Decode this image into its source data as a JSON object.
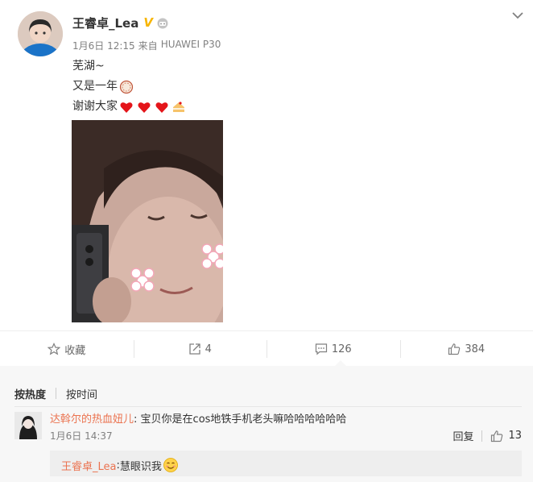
{
  "post": {
    "author": "王睿卓_Lea",
    "date": "1月6日 12:15",
    "source_prefix": "来自",
    "source": "HUAWEI P30",
    "lines": [
      "芜湖~",
      "又是一年",
      "谢谢大家"
    ]
  },
  "icons": {
    "verified": "verified-v-icon",
    "bot": "robot-icon",
    "dropdown": "chevron-down-icon",
    "star": "star-icon",
    "repost": "repost-icon",
    "comment": "comment-icon",
    "like": "thumbs-up-icon"
  },
  "actions": {
    "favorite_label": "收藏",
    "repost_count": "4",
    "comment_count": "126",
    "like_count": "384"
  },
  "sort": {
    "hot": "按热度",
    "time": "按时间"
  },
  "comment": {
    "user": "达斡尔的热血妞儿",
    "separator": ":",
    "text": "宝贝你是在cos地铁手机老头嘛哈哈哈哈哈哈",
    "time": "1月6日 14:37",
    "reply_label": "回复",
    "like_count": "13"
  },
  "reply": {
    "user": "王睿卓_Lea",
    "separator": ":",
    "text": "慧眼识我"
  },
  "colors": {
    "verified": "#f7b500",
    "username": "#eb7350",
    "heart": "#e4151a",
    "meta": "#808080"
  }
}
